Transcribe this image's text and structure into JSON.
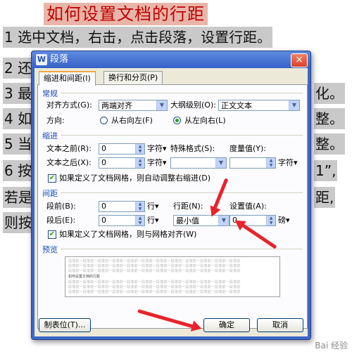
{
  "document": {
    "title": "如何设置文档的行距",
    "lines": [
      "1 选中文档，右击，点击段落，设置行距。",
      "2 还",
      "3 最",
      "4 如",
      "5 当",
      "6 按",
      "若是",
      "则按"
    ],
    "right_fragments": [
      "化。",
      "整。",
      "整。",
      "1”,",
      "距,"
    ],
    "watermark": "Bai 经验"
  },
  "dialog": {
    "title": "段落",
    "close": "×",
    "tabs": [
      "缩进和间距(I)",
      "换行和分页(P)"
    ],
    "general": {
      "section": "常规",
      "align_label": "对齐方式(G):",
      "align_value": "两端对齐",
      "outline_label": "大纲级别(O):",
      "outline_value": "正文文本",
      "direction_label": "方向:",
      "rtl_label": "从右向左(F)",
      "ltr_label": "从左向右(L)"
    },
    "indent": {
      "section": "缩进",
      "before_label": "文本之前(R):",
      "before_value": "0",
      "before_unit": "字符▾",
      "special_label": "特殊格式(S):",
      "special_value": "",
      "measure_label": "度量值(Y):",
      "measure_value": "",
      "measure_unit": "字符▾",
      "after_label": "文本之后(X):",
      "after_value": "0",
      "after_unit": "字符▾",
      "grid_check": "如果定义了文档网格，则自动调整右缩进(D)"
    },
    "spacing": {
      "section": "间距",
      "before_label": "段前(B):",
      "before_value": "0",
      "before_unit": "行▾",
      "line_label": "行距(N):",
      "line_value": "最小值",
      "set_label": "设置值(A):",
      "set_value": "0",
      "set_unit": "磅▾",
      "after_label": "段后(E):",
      "after_value": "0",
      "after_unit": "行▾",
      "grid_check": "如果定义了文档网格，则与网格对齐(W)"
    },
    "preview": {
      "section": "预览",
      "sample": "段落前一段落前一段落前一段落前一段落前一段落前一段落前一段落前一段落前一段落前一段落前一段落前",
      "main": "如何设置文档的行距"
    },
    "buttons": {
      "tabs": "制表位(T)...",
      "ok": "确定",
      "cancel": "取消"
    }
  },
  "colors": {
    "title_text": "#c00000",
    "title_highlight": "#e9b5a8",
    "text_highlight": "#c9c9c9",
    "annotation_arrow": "#e8232a",
    "dialog_frame": "#3d67c8"
  }
}
